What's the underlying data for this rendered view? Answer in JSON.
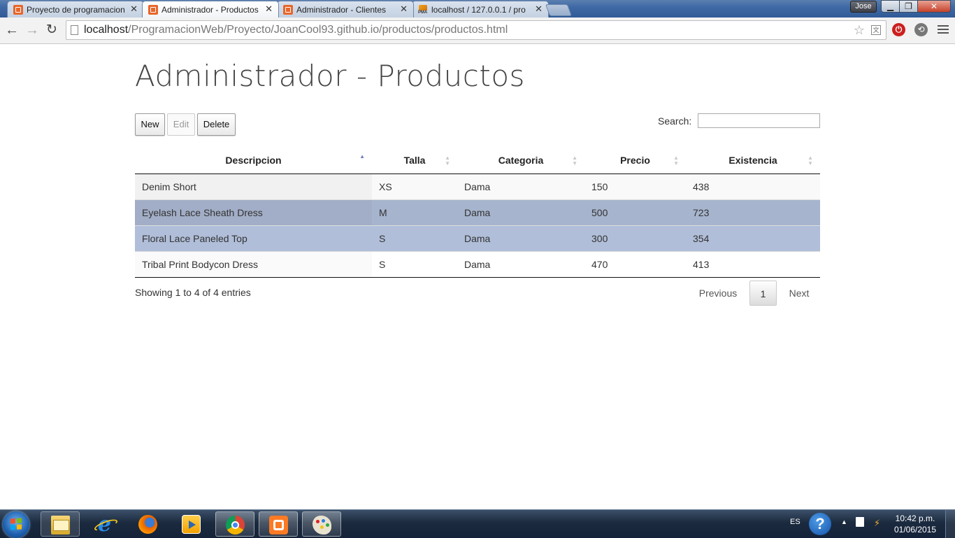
{
  "browser": {
    "tabs": [
      {
        "title": "Proyecto de programacion",
        "close": "✕",
        "favicon": "xampp-icon",
        "active": false
      },
      {
        "title": "Administrador - Productos",
        "close": "✕",
        "favicon": "xampp-icon",
        "active": true
      },
      {
        "title": "Administrador - Clientes",
        "close": "✕",
        "favicon": "xampp-icon",
        "active": false
      },
      {
        "title": "localhost / 127.0.0.1 / pro",
        "close": "✕",
        "favicon": "phpmyadmin-icon",
        "active": false
      }
    ],
    "user_name": "Jose",
    "url_host": "localhost",
    "url_path": "/ProgramacionWeb/Proyecto/JoanCool93.github.io/productos/productos.html"
  },
  "page": {
    "title": "Administrador - Productos",
    "buttons": {
      "new": "New",
      "edit": "Edit",
      "delete": "Delete"
    },
    "search": {
      "label": "Search:",
      "value": ""
    },
    "table": {
      "columns": [
        "Descripcion",
        "Talla",
        "Categoria",
        "Precio",
        "Existencia"
      ],
      "sorted_column": "Descripcion",
      "sort_direction": "ascending",
      "rows": [
        {
          "descripcion": "Denim Short",
          "talla": "XS",
          "categoria": "Dama",
          "precio": "150",
          "existencia": "438",
          "selected": false
        },
        {
          "descripcion": "Eyelash Lace Sheath Dress",
          "talla": "M",
          "categoria": "Dama",
          "precio": "500",
          "existencia": "723",
          "selected": true
        },
        {
          "descripcion": "Floral Lace Paneled Top",
          "talla": "S",
          "categoria": "Dama",
          "precio": "300",
          "existencia": "354",
          "selected": true
        },
        {
          "descripcion": "Tribal Print Bodycon Dress",
          "talla": "S",
          "categoria": "Dama",
          "precio": "470",
          "existencia": "413",
          "selected": false
        }
      ]
    },
    "info": "Showing 1 to 4 of 4 entries",
    "pagination": {
      "previous": "Previous",
      "current": "1",
      "next": "Next"
    }
  },
  "taskbar": {
    "apps": [
      "file-explorer-icon",
      "internet-explorer-icon",
      "firefox-icon",
      "media-player-icon",
      "chrome-icon",
      "xampp-icon",
      "paint-icon"
    ],
    "language": "ES",
    "time": "10:42 p.m.",
    "date": "01/06/2015"
  },
  "colors": {
    "selected_row": "#b0bed9",
    "sort_indicator": "#6f7fbf",
    "taskbar": "#1b2a3e"
  }
}
